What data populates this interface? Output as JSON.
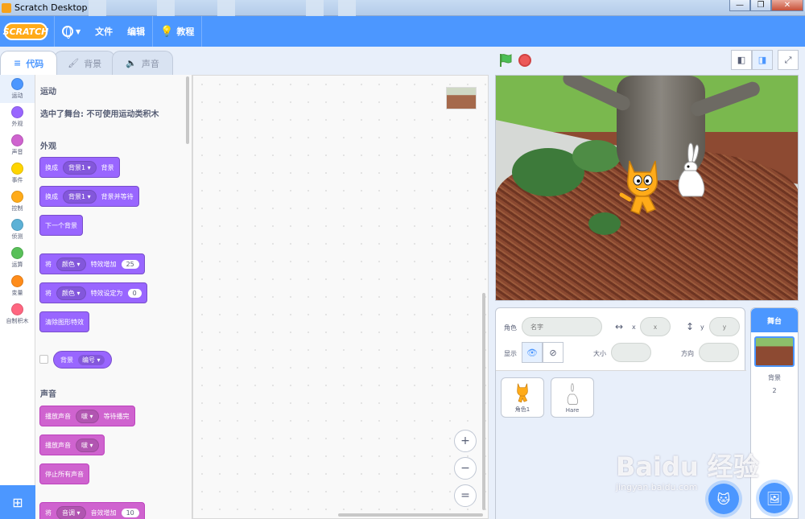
{
  "window": {
    "title": "Scratch Desktop",
    "controls": [
      "—",
      "❐",
      "✕"
    ]
  },
  "menubar": {
    "logo": "SCRATCH",
    "file": "文件",
    "edit": "编辑",
    "tutorials": "教程"
  },
  "tabs": [
    {
      "label": "代码",
      "icon": "code-icon"
    },
    {
      "label": "背景",
      "icon": "brush-icon"
    },
    {
      "label": "声音",
      "icon": "speaker-icon"
    }
  ],
  "categories": [
    {
      "label": "运动",
      "color": "#4c97ff"
    },
    {
      "label": "外观",
      "color": "#9966ff"
    },
    {
      "label": "声音",
      "color": "#cf63cf"
    },
    {
      "label": "事件",
      "color": "#ffd500"
    },
    {
      "label": "控制",
      "color": "#ffab19"
    },
    {
      "label": "侦测",
      "color": "#5cb1d6"
    },
    {
      "label": "运算",
      "color": "#59c059"
    },
    {
      "label": "变量",
      "color": "#ff8c1a"
    },
    {
      "label": "自制积木",
      "color": "#ff6680"
    }
  ],
  "palette": {
    "motion_title": "运动",
    "motion_note": "选中了舞台: 不可使用运动类积木",
    "looks_title": "外观",
    "b1": {
      "pre": "换成",
      "dd": "背景1 ▾",
      "post": "背景"
    },
    "b2": {
      "pre": "换成",
      "dd": "背景1 ▾",
      "post": "背景并等待"
    },
    "b3": {
      "pre": "下一个背景"
    },
    "b4": {
      "pre": "将",
      "dd": "颜色 ▾",
      "post": "特效增加",
      "num": "25"
    },
    "b5": {
      "pre": "将",
      "dd": "颜色 ▾",
      "post": "特效设定为",
      "num": "0"
    },
    "b6": {
      "pre": "清除图形特效"
    },
    "r1": {
      "pre": "背景",
      "dd": "编号 ▾"
    },
    "sound_title": "声音",
    "s1": {
      "pre": "播放声音",
      "dd": "啵 ▾",
      "post": "等待播完"
    },
    "s2": {
      "pre": "播放声音",
      "dd": "啵 ▾"
    },
    "s3": {
      "pre": "停止所有声音"
    },
    "s4": {
      "pre": "将",
      "dd": "音调 ▾",
      "post": "音效增加",
      "num": "10"
    }
  },
  "zoom": {
    "in": "+",
    "out": "−",
    "reset": "="
  },
  "sprite_info": {
    "sprite_label": "角色",
    "name_placeholder": "名字",
    "x_label": "x",
    "x_placeholder": "x",
    "y_label": "y",
    "y_placeholder": "y",
    "show_label": "显示",
    "size_label": "大小",
    "direction_label": "方向"
  },
  "sprites": [
    {
      "name": "角色1"
    },
    {
      "name": "Hare"
    }
  ],
  "stage_pane": {
    "header": "舞台",
    "backdrops_label": "背景",
    "backdrops_count": "2"
  },
  "watermark": {
    "text": "Baidu 经验",
    "sub": "jingyan.baidu.com"
  }
}
